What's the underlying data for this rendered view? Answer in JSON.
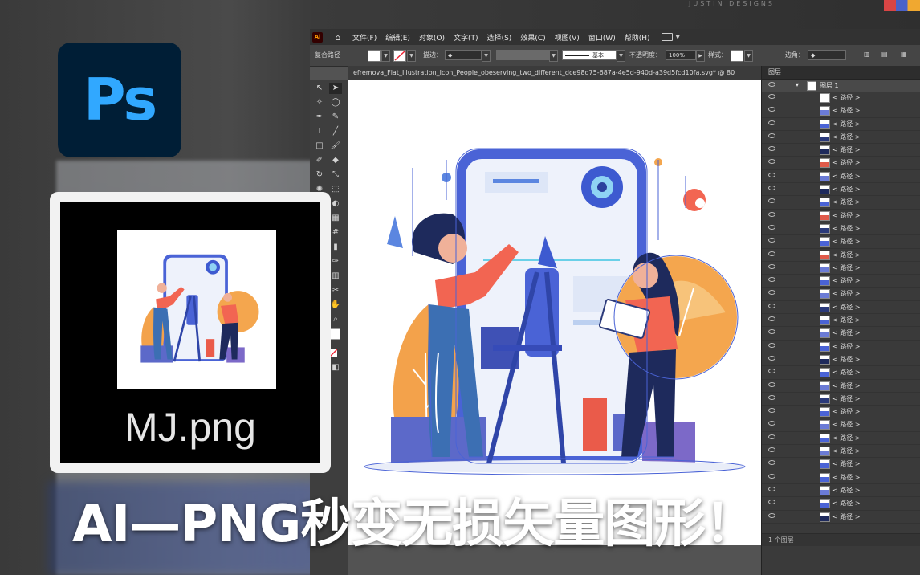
{
  "watermark": "JUSTIN DESIGNS",
  "ps_logo": {
    "text": "Ps"
  },
  "mj_card": {
    "filename": "MJ.png"
  },
  "headline": "AI—PNG秒变无损矢量图形！",
  "app": {
    "logo": "Ai",
    "menu": [
      "文件(F)",
      "编辑(E)",
      "对象(O)",
      "文字(T)",
      "选择(S)",
      "效果(C)",
      "视图(V)",
      "窗口(W)",
      "帮助(H)"
    ]
  },
  "control": {
    "selection_type": "复合路径",
    "stroke_label": "描边：",
    "stroke_style": "基本",
    "opacity_label": "不透明度：",
    "opacity_value": "100%",
    "style_label": "样式：",
    "align_label": "边角："
  },
  "document_tab": "efremova_Flat_Illustration_Icon_People_obeserving_two_different_dce98d75-687a-4e5d-940d-a39d5fcd10fa.svg* @ 80",
  "layers_panel": {
    "tab": "图层",
    "layer_name": "图层 1",
    "path_label": "< 路径 >",
    "footer": "1 个图层"
  },
  "colors": {
    "accent": "#31a8ff",
    "ps_bg": "#001e36",
    "selection": "#4a63d6"
  }
}
